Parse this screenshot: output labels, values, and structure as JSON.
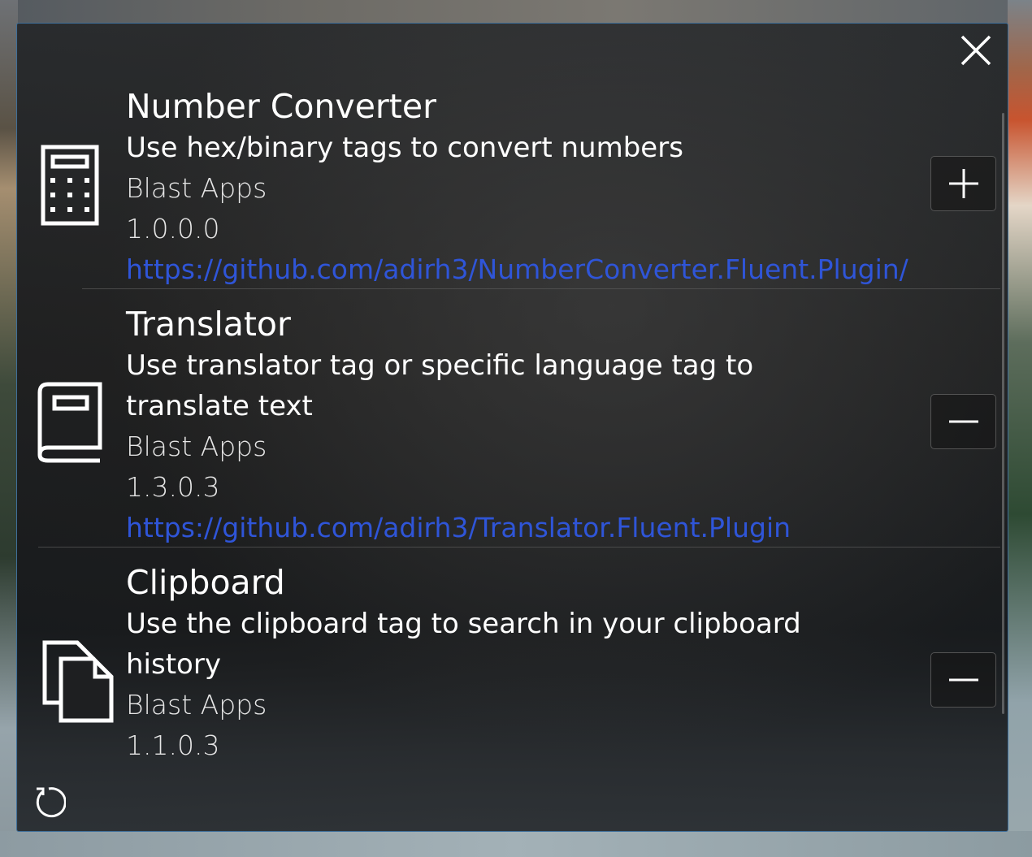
{
  "window": {
    "close_icon": "close-icon",
    "refresh_icon": "refresh-icon"
  },
  "plugins": [
    {
      "icon": "calculator-icon",
      "name": "Number Converter",
      "description": [
        "Use hex/binary tags to convert numbers"
      ],
      "author": "Blast Apps",
      "version": "1.0.0.0",
      "url": "https://github.com/adirh3/NumberConverter.Fluent.Plugin/",
      "action": "install",
      "action_icon": "plus-icon"
    },
    {
      "icon": "book-icon",
      "name": "Translator",
      "description": [
        "Use translator tag or specific language tag to",
        "translate text"
      ],
      "author": "Blast Apps",
      "version": "1.3.0.3",
      "url": "https://github.com/adirh3/Translator.Fluent.Plugin",
      "action": "uninstall",
      "action_icon": "minus-icon"
    },
    {
      "icon": "copy-icon",
      "name": "Clipboard",
      "description": [
        "Use the clipboard tag to search in your clipboard",
        "history"
      ],
      "author": "Blast Apps",
      "version": "1.1.0.3",
      "url": "",
      "action": "uninstall",
      "action_icon": "minus-icon"
    }
  ],
  "colors": {
    "link": "#2f55d8",
    "border": "#3f6f9a"
  }
}
